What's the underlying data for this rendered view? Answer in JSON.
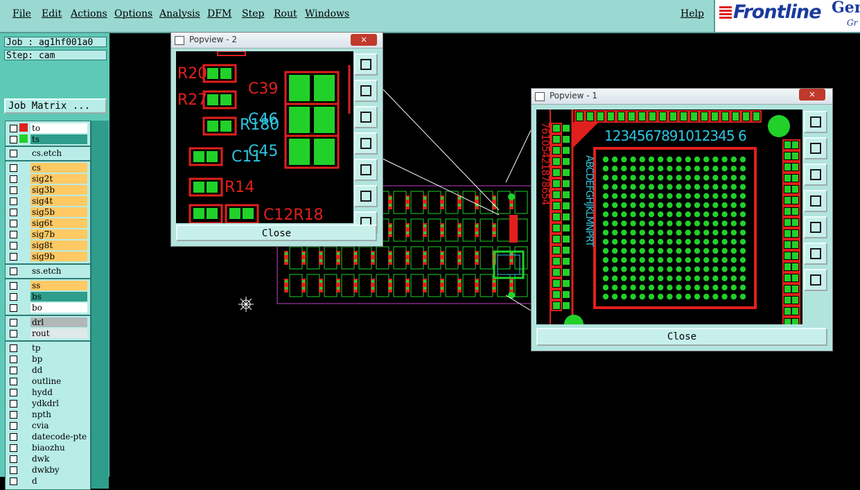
{
  "menu": {
    "file": "File",
    "edit": "Edit",
    "actions": "Actions",
    "options": "Options",
    "analysis": "Analysis",
    "dfm": "DFM",
    "step": "Step",
    "rout": "Rout",
    "windows": "Windows",
    "help": "Help"
  },
  "logo": {
    "brand": "Frontline",
    "product": "Gen",
    "sub": "Gr"
  },
  "job": {
    "job_label": "Job : ag1hf001a0",
    "step_label": "Step: cam",
    "matrix_button": "Job Matrix ..."
  },
  "layers": [
    {
      "name": "to",
      "color": "#ffffff"
    },
    {
      "name": "ts",
      "color": "#2f9d8b"
    },
    {
      "name": "cs.etch",
      "color": "#b7ece7"
    },
    {
      "name": "cs",
      "color": "#ffc964"
    },
    {
      "name": "sig2t",
      "color": "#ffc964"
    },
    {
      "name": "sig3b",
      "color": "#ffc964"
    },
    {
      "name": "sig4t",
      "color": "#ffc964"
    },
    {
      "name": "sig5b",
      "color": "#ffc964"
    },
    {
      "name": "sig6t",
      "color": "#ffc964"
    },
    {
      "name": "sig7b",
      "color": "#ffc964"
    },
    {
      "name": "sig8t",
      "color": "#ffc964"
    },
    {
      "name": "sig9b",
      "color": "#ffc964"
    },
    {
      "name": "ss.etch",
      "color": "#b7ece7"
    },
    {
      "name": "ss",
      "color": "#ffc964"
    },
    {
      "name": "bs",
      "color": "#2f9d8b"
    },
    {
      "name": "bo",
      "color": "#ffffff"
    },
    {
      "name": "drl",
      "color": "#b0b8b8"
    },
    {
      "name": "rout",
      "color": "#e0e8e8"
    },
    {
      "name": "tp",
      "color": "#b7ece7"
    },
    {
      "name": "bp",
      "color": "#b7ece7"
    },
    {
      "name": "dd",
      "color": "#b7ece7"
    },
    {
      "name": "outline",
      "color": "#b7ece7"
    },
    {
      "name": "hydd",
      "color": "#b7ece7"
    },
    {
      "name": "ydkdrl",
      "color": "#b7ece7"
    },
    {
      "name": "npth",
      "color": "#b7ece7"
    },
    {
      "name": "cvia",
      "color": "#b7ece7"
    },
    {
      "name": "datecode-pte",
      "color": "#b7ece7"
    },
    {
      "name": "biaozhu",
      "color": "#b7ece7"
    },
    {
      "name": "dwk",
      "color": "#b7ece7"
    },
    {
      "name": "dwkby",
      "color": "#b7ece7"
    },
    {
      "name": "d",
      "color": "#b7ece7"
    }
  ],
  "popview2": {
    "title": "Popview - 2",
    "close_x": "×",
    "close_button": "Close",
    "refs": {
      "r20": "R20",
      "r27": "R27",
      "c39": "C39",
      "c46": "C46",
      "r180": "R180",
      "c11": "C11",
      "c45": "C45",
      "r14": "R14",
      "c12r18": "C12R18"
    }
  },
  "popview1": {
    "title": "Popview - 1",
    "close_x": "×",
    "close_button": "Close",
    "column_numbers": "1234567891012345 6",
    "row_letters": "ABCDEFGHJKLMNPRT",
    "left_digits": "76105421878654"
  }
}
